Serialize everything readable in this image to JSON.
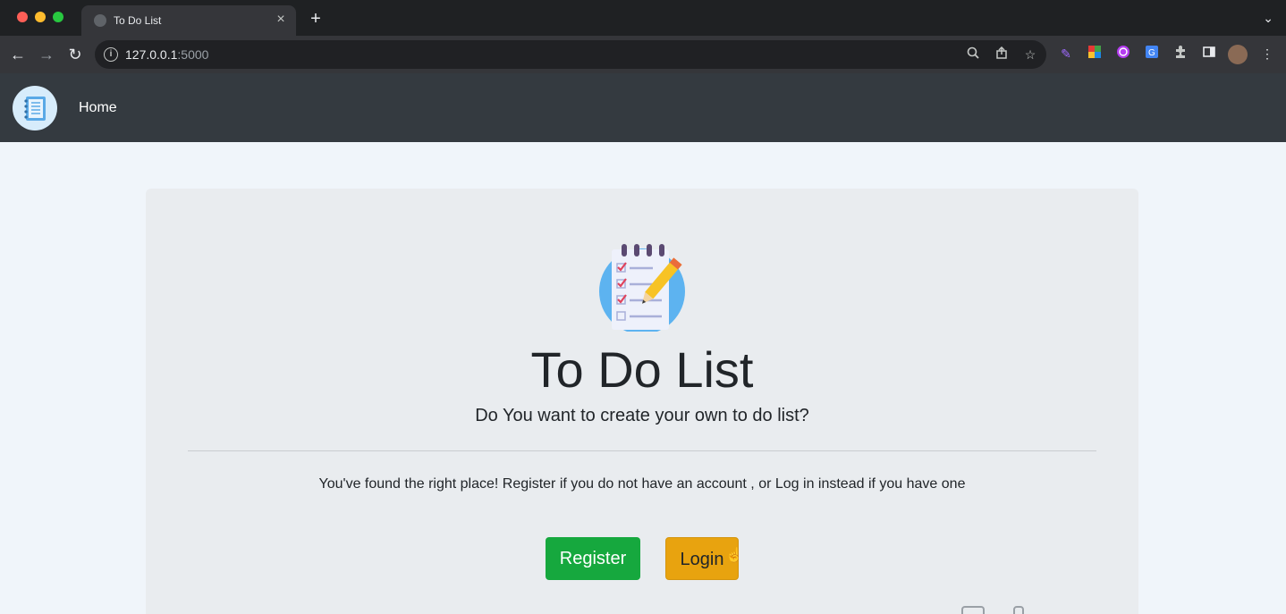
{
  "browser": {
    "tab_title": "To Do List",
    "tab_close": "×",
    "new_tab": "+",
    "tab_menu": "⌄",
    "url_host": "127.0.0.1",
    "url_port": ":5000"
  },
  "navbar": {
    "home_label": "Home"
  },
  "main": {
    "title": "To Do List",
    "lead": "Do You want to create your own to do list?",
    "body": "You've found the right place! Register if you do not have an account , or Log in instead if you have one",
    "register_label": "Register",
    "login_label": "Login"
  },
  "colors": {
    "register": "#16a83e",
    "login": "#e8a30f",
    "navbar": "#343a40",
    "jumbotron": "#e9ecef"
  }
}
